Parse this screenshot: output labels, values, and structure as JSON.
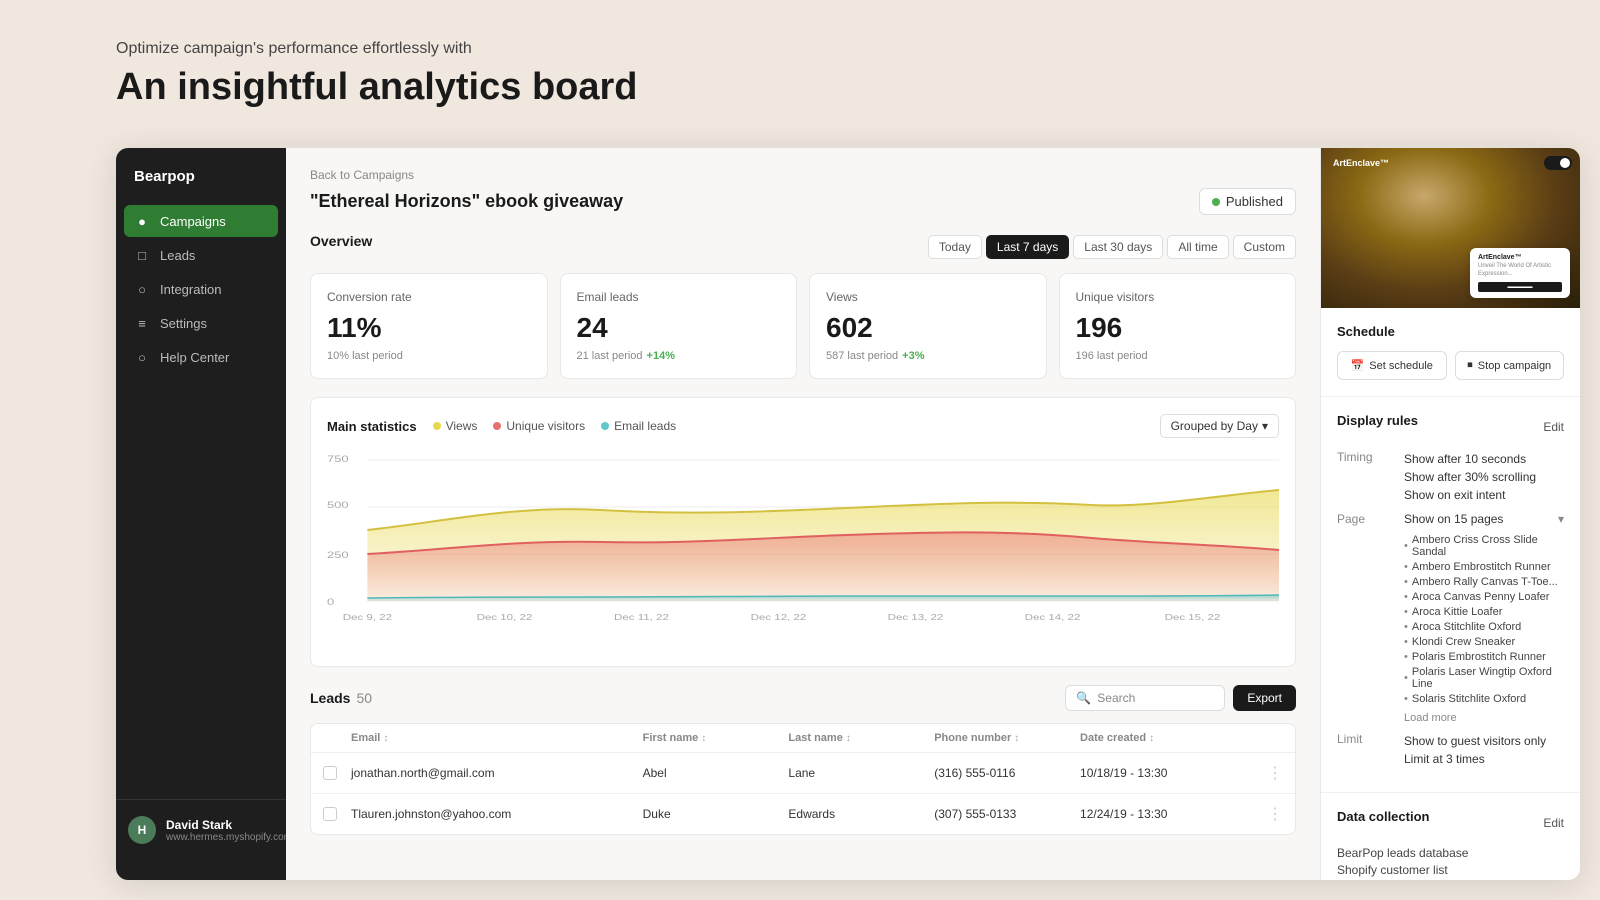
{
  "hero": {
    "subtitle": "Optimize campaign's performance effortlessly with",
    "title": "An insightful analytics board"
  },
  "sidebar": {
    "brand": "Bearpop",
    "nav_items": [
      {
        "id": "campaigns",
        "label": "Campaigns",
        "icon": "●",
        "active": true
      },
      {
        "id": "leads",
        "label": "Leads",
        "icon": "□"
      },
      {
        "id": "integration",
        "label": "Integration",
        "icon": "○"
      },
      {
        "id": "settings",
        "label": "Settings",
        "icon": "≡"
      },
      {
        "id": "help",
        "label": "Help Center",
        "icon": "○"
      }
    ],
    "user": {
      "name": "David Stark",
      "email": "www.hermes.myshopify.com",
      "avatar_initial": "H"
    }
  },
  "campaign": {
    "back_label": "Back to Campaigns",
    "title": "\"Ethereal Horizons\" ebook giveaway",
    "status": "Published"
  },
  "overview": {
    "section_label": "Overview",
    "time_filters": [
      "Today",
      "Last 7 days",
      "Last 30 days",
      "All time",
      "Custom"
    ],
    "active_filter": "Last 7 days",
    "stats": [
      {
        "label": "Conversion rate",
        "value": "11%",
        "meta": "10% last period",
        "change": null
      },
      {
        "label": "Email leads",
        "value": "24",
        "meta": "21 last period",
        "change": "+14%",
        "change_up": true
      },
      {
        "label": "Views",
        "value": "602",
        "meta": "587 last period",
        "change": "+3%",
        "change_up": true
      },
      {
        "label": "Unique visitors",
        "value": "196",
        "meta": "196 last period",
        "change": "–",
        "change_up": false
      }
    ]
  },
  "chart": {
    "title": "Main statistics",
    "legend": [
      {
        "label": "Views",
        "color": "#f0e080"
      },
      {
        "label": "Unique visitors",
        "color": "#f08080"
      },
      {
        "label": "Email leads",
        "color": "#80d0d0"
      }
    ],
    "group_by": "Grouped by Day",
    "y_labels": [
      "750",
      "500",
      "250",
      "0"
    ],
    "x_labels": [
      "Dec 9, 22",
      "Dec 10, 22",
      "Dec 11, 22",
      "Dec 12, 22",
      "Dec 13, 22",
      "Dec 14, 22",
      "Dec 15, 22"
    ]
  },
  "leads_table": {
    "section_label": "Leads",
    "count": "50",
    "search_placeholder": "Search",
    "export_label": "Export",
    "columns": [
      "Email",
      "First name",
      "Last name",
      "Phone number",
      "Date created"
    ],
    "rows": [
      {
        "email": "jonathan.north@gmail.com",
        "first_name": "Abel",
        "last_name": "Lane",
        "phone": "(316) 555-0116",
        "date": "10/18/19 - 13:30"
      },
      {
        "email": "Tlauren.johnston@yahoo.com",
        "first_name": "Duke",
        "last_name": "Edwards",
        "phone": "(307) 555-0133",
        "date": "12/24/19 - 13:30"
      }
    ]
  },
  "right_panel": {
    "schedule": {
      "title": "Schedule",
      "set_schedule_label": "Set schedule",
      "stop_campaign_label": "Stop campaign"
    },
    "display_rules": {
      "title": "Display rules",
      "edit_label": "Edit",
      "timing_label": "Timing",
      "timing_values": [
        "Show after 10 seconds",
        "Show after 30% scrolling",
        "Show on exit intent"
      ],
      "page_label": "Page",
      "page_show": "Show on 15 pages",
      "pages": [
        "Ambero Criss Cross Slide Sandal",
        "Ambero Embrostitch Runner",
        "Ambero Rally Canvas T-Toe...",
        "Aroca Canvas Penny Loafer",
        "Aroca Kittie Loafer",
        "Aroca Stitchlite Oxford",
        "Klondi Crew Sneaker",
        "Polaris Embrostitch Runner",
        "Polaris Laser Wingtip Oxford Line",
        "Solaris Stitchlite Oxford"
      ],
      "load_more_label": "Load more",
      "limit_label": "Limit",
      "limit_values": [
        "Show to guest visitors only",
        "Limit at 3 times"
      ]
    },
    "data_collection": {
      "title": "Data collection",
      "edit_label": "Edit",
      "items": [
        "BearPop leads database",
        "Shopify customer list"
      ]
    }
  }
}
